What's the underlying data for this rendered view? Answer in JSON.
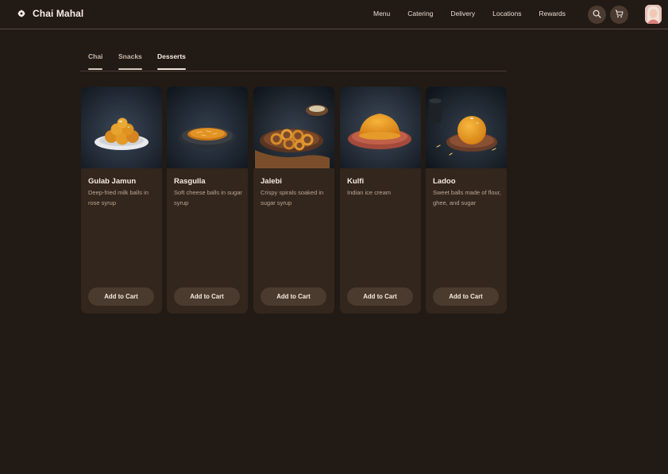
{
  "brand": {
    "name": "Chai Mahal",
    "icon": "flower-icon"
  },
  "nav": {
    "items": [
      "Menu",
      "Catering",
      "Delivery",
      "Locations",
      "Rewards"
    ]
  },
  "header_icons": {
    "search": "search-icon",
    "cart": "cart-icon"
  },
  "tabs": [
    {
      "label": "Chai",
      "active": false
    },
    {
      "label": "Snacks",
      "active": false
    },
    {
      "label": "Desserts",
      "active": true
    }
  ],
  "products": [
    {
      "name": "Gulab Jamun",
      "description": "Deep-fried milk balls in rose syrup",
      "button": "Add to Cart"
    },
    {
      "name": "Rasgulla",
      "description": "Soft cheese balls in sugar syrup",
      "button": "Add to Cart"
    },
    {
      "name": "Jalebi",
      "description": "Crispy spirals soaked in sugar syrup",
      "button": "Add to Cart"
    },
    {
      "name": "Kulfi",
      "description": "Indian ice cream",
      "button": "Add to Cart"
    },
    {
      "name": "Ladoo",
      "description": "Sweet balls made of flour, ghee, and sugar",
      "button": "Add to Cart"
    }
  ],
  "colors": {
    "background": "#221a15",
    "card": "#33261c",
    "button": "#4b3a2e",
    "text": "#f6ece2",
    "muted_text": "#b9a797"
  }
}
